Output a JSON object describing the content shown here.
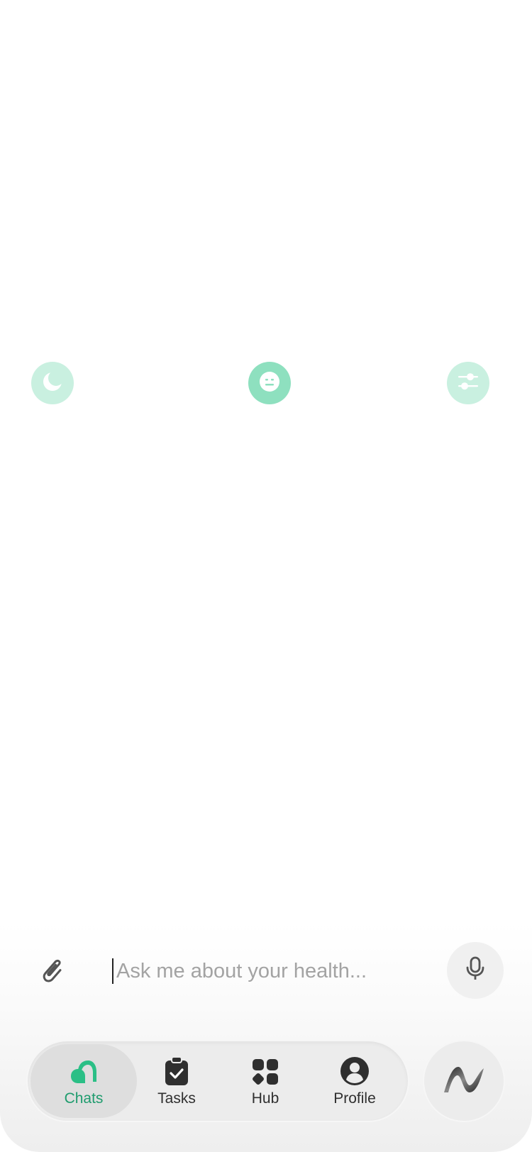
{
  "quick_actions": [
    {
      "icon": "moon-icon",
      "color": "#c9f0e0"
    },
    {
      "icon": "neutral-face-icon",
      "color": "#8ee0bf"
    },
    {
      "icon": "sliders-icon",
      "color": "#c9f0e0"
    }
  ],
  "composer": {
    "placeholder": "Ask me about your health...",
    "attach_icon": "paperclip-icon",
    "mic_icon": "microphone-icon"
  },
  "tabs": [
    {
      "label": "Chats",
      "icon": "chats-icon",
      "active": true
    },
    {
      "label": "Tasks",
      "icon": "clipboard-check-icon",
      "active": false
    },
    {
      "label": "Hub",
      "icon": "grid-icon",
      "active": false
    },
    {
      "label": "Profile",
      "icon": "user-circle-icon",
      "active": false
    }
  ],
  "assistant": {
    "icon": "wave-logo-icon"
  },
  "colors": {
    "accent": "#1f9c6e",
    "accent_light": "#c9f0e0",
    "accent_mid": "#8ee0bf",
    "tab_bg": "#ececec"
  }
}
